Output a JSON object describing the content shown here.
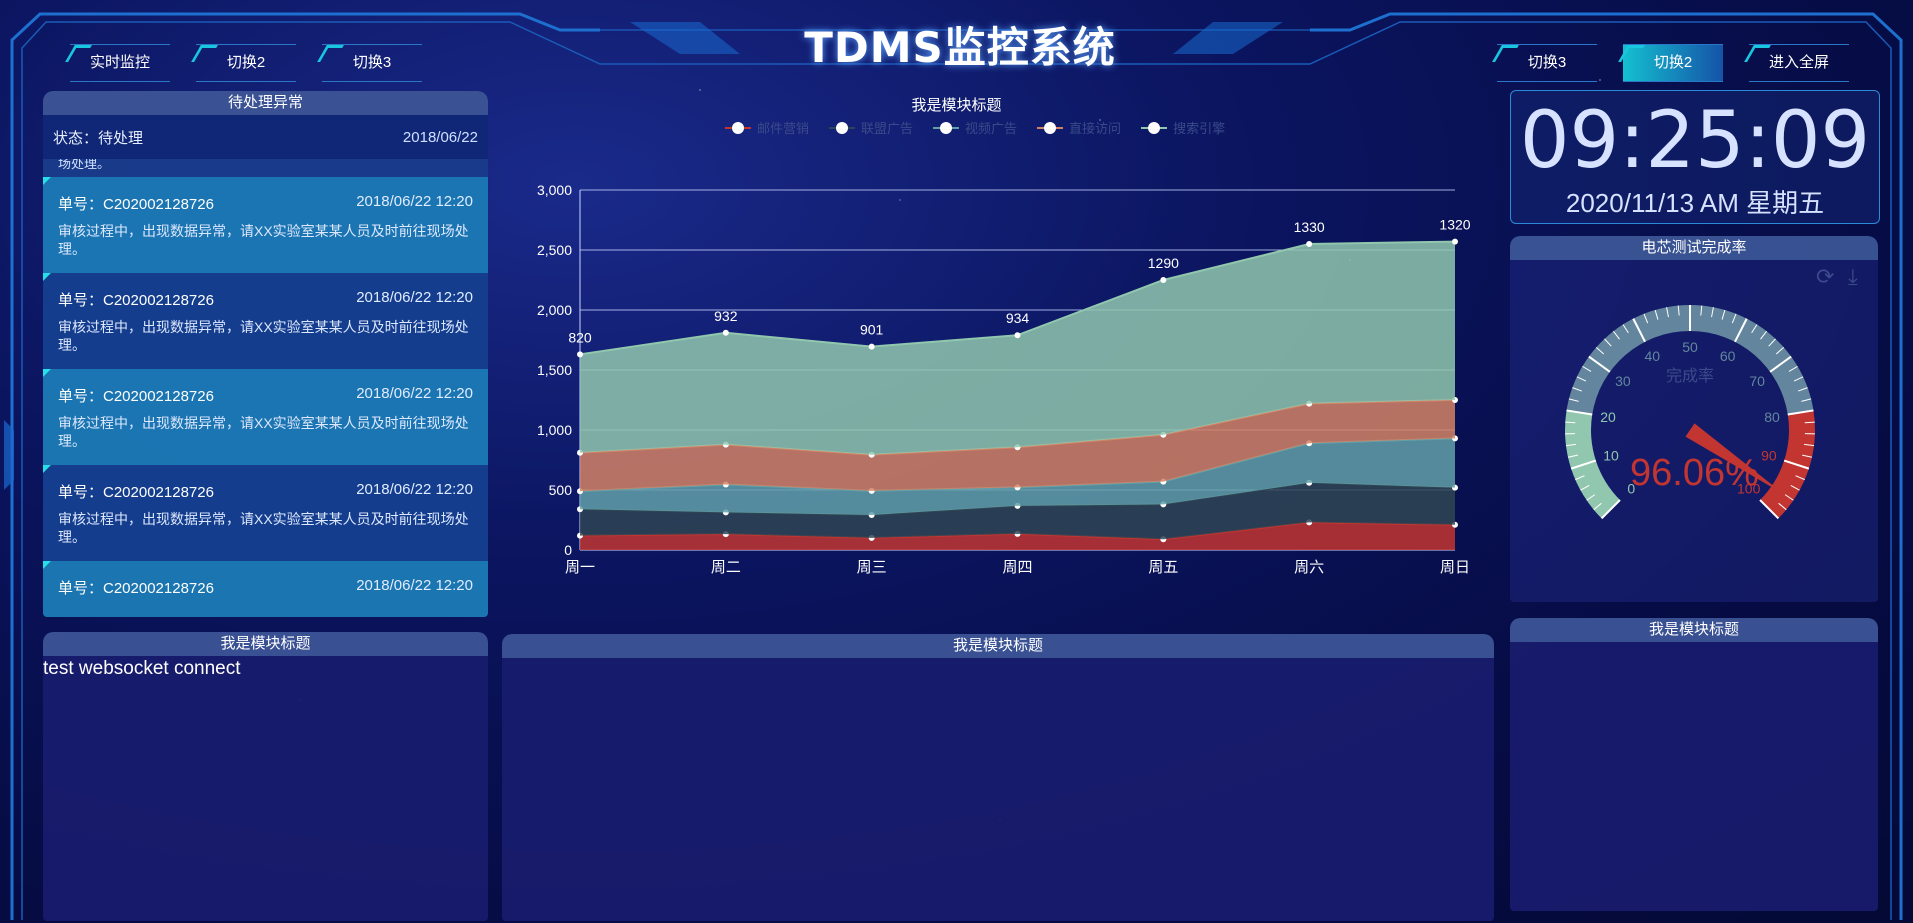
{
  "header": {
    "title": "TDMS监控系统",
    "left_nav": [
      "实时监控",
      "切换2",
      "切换3"
    ],
    "right_nav": [
      "切换3",
      "切换2",
      "进入全屏"
    ],
    "right_active_index": 1
  },
  "alarms": {
    "title": "待处理异常",
    "status_label": "状态：待处理",
    "status_date": "2018/06/22",
    "cut_text": "场处理。",
    "items": [
      {
        "no": "单号：C202002128726",
        "date": "2018/06/22 12:20",
        "desc": "审核过程中，出现数据异常，请XX实验室某某人员及时前往现场处理。"
      },
      {
        "no": "单号：C202002128726",
        "date": "2018/06/22 12:20",
        "desc": "审核过程中，出现数据异常，请XX实验室某某人员及时前往现场处理。"
      },
      {
        "no": "单号：C202002128726",
        "date": "2018/06/22 12:20",
        "desc": "审核过程中，出现数据异常，请XX实验室某某人员及时前往现场处理。"
      },
      {
        "no": "单号：C202002128726",
        "date": "2018/06/22 12:20",
        "desc": "审核过程中，出现数据异常，请XX实验室某某人员及时前往现场处理。"
      },
      {
        "no": "单号：C202002128726",
        "date": "2018/06/22 12:20",
        "desc": ""
      }
    ]
  },
  "chart_data": {
    "type": "area",
    "title": "我是模块标题",
    "stacked": true,
    "categories": [
      "周一",
      "周二",
      "周三",
      "周四",
      "周五",
      "周六",
      "周日"
    ],
    "ylim": [
      0,
      3000
    ],
    "yticks": [
      "0",
      "500",
      "1,000",
      "1,500",
      "2,000",
      "2,500",
      "3,000"
    ],
    "series": [
      {
        "name": "邮件营销",
        "color": "#c23531",
        "values": [
          120,
          132,
          101,
          134,
          90,
          230,
          210
        ]
      },
      {
        "name": "联盟广告",
        "color": "#2f4554",
        "values": [
          220,
          182,
          191,
          234,
          290,
          330,
          310
        ]
      },
      {
        "name": "视频广告",
        "color": "#61a0a8",
        "values": [
          150,
          232,
          201,
          154,
          190,
          330,
          410
        ]
      },
      {
        "name": "直接访问",
        "color": "#d48265",
        "values": [
          320,
          332,
          301,
          334,
          390,
          330,
          320
        ]
      },
      {
        "name": "搜索引擎",
        "color": "#91c7ae",
        "values": [
          820,
          932,
          901,
          934,
          1290,
          1330,
          1320
        ]
      }
    ],
    "top_labels": [
      "820",
      "932",
      "901",
      "934",
      "1290",
      "1330",
      "1320"
    ],
    "grid": true,
    "legend_position": "top"
  },
  "clock": {
    "time": "09:25:09",
    "date": "2020/11/13 AM 星期五"
  },
  "gauge": {
    "title": "电芯测试完成率",
    "name": "完成率",
    "value": 96.06,
    "value_text": "96.06%",
    "labels": [
      "0",
      "10",
      "20",
      "30",
      "40",
      "50",
      "60",
      "70",
      "80",
      "90",
      "100"
    ],
    "colors": [
      "#91c7ae",
      "#63869e",
      "#c23531"
    ]
  },
  "bottom": {
    "left_title": "我是模块标题",
    "center_title": "我是模块标题",
    "right_title": "我是模块标题",
    "ws_text": "test websocket connect"
  }
}
